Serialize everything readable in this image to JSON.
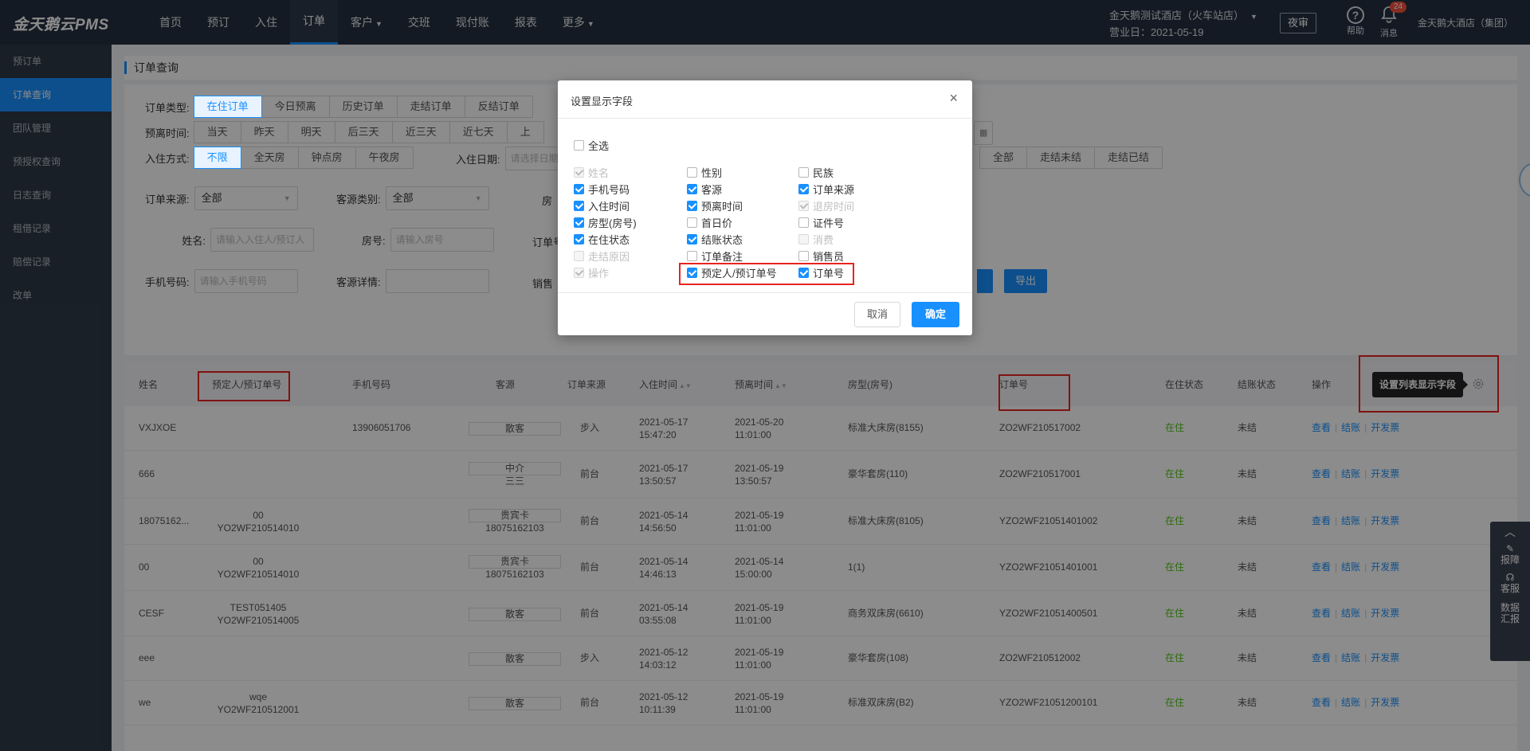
{
  "app": {
    "logo": "金天鹅云PMS"
  },
  "nav": {
    "items": [
      {
        "label": "首页"
      },
      {
        "label": "预订"
      },
      {
        "label": "入住"
      },
      {
        "label": "订单"
      },
      {
        "label": "客户"
      },
      {
        "label": "交班"
      },
      {
        "label": "现付账"
      },
      {
        "label": "报表"
      },
      {
        "label": "更多"
      }
    ]
  },
  "header": {
    "hotel_name": "金天鹅测试酒店（火车站店）",
    "business_date": "营业日：2021-05-19",
    "night_audit": "夜审",
    "help": "帮助",
    "messages": "消息",
    "message_count": "24",
    "group": "金天鹅大酒店（集团）"
  },
  "sidebar": {
    "items": [
      {
        "label": "预订单"
      },
      {
        "label": "订单查询"
      },
      {
        "label": "团队管理"
      },
      {
        "label": "预授权查询"
      },
      {
        "label": "日志查询"
      },
      {
        "label": "租借记录"
      },
      {
        "label": "赔偿记录"
      },
      {
        "label": "改单"
      }
    ]
  },
  "page": {
    "title": "订单查询"
  },
  "filters": {
    "order_type": {
      "label": "订单类型:",
      "options": [
        "在住订单",
        "今日预离",
        "历史订单",
        "走结订单",
        "反结订单"
      ]
    },
    "departure": {
      "label": "预离时间:",
      "options": [
        "当天",
        "昨天",
        "明天",
        "后三天",
        "近三天",
        "近七天",
        "上"
      ]
    },
    "checkin_mode": {
      "label": "入住方式:",
      "options": [
        "不限",
        "全天房",
        "钟点房",
        "午夜房"
      ]
    },
    "checkin_date": {
      "label": "入住日期:",
      "placeholder": "请选择日期"
    },
    "settle": {
      "options": [
        "全部",
        "走结未结",
        "走结已结"
      ]
    },
    "order_source": {
      "label": "订单来源:",
      "value": "全部"
    },
    "guest_type": {
      "label": "客源类别:",
      "value": "全部"
    },
    "room_type_label": "房",
    "name": {
      "label": "姓名:",
      "placeholder": "请输入入住人/预订人"
    },
    "room_no": {
      "label": "房号:",
      "placeholder": "请输入房号"
    },
    "order_no_label": "订单号",
    "phone": {
      "label": "手机号码:",
      "placeholder": "请输入手机号码"
    },
    "guest_detail": {
      "label": "客源详情:"
    },
    "seller_label": "销售",
    "export": "导出"
  },
  "table": {
    "headers": [
      "姓名",
      "预定人/预订单号",
      "手机号码",
      "客源",
      "订单来源",
      "入住时间",
      "预离时间",
      "房型(房号)",
      "订单号",
      "在住状态",
      "结账状态",
      "操作"
    ],
    "tooltip": "设置列表显示字段",
    "actions": {
      "view": "查看",
      "settle": "结账",
      "invoice": "开发票"
    },
    "rows": [
      {
        "name": "VXJXOE",
        "booker": "",
        "booker_no": "",
        "phone": "13906051706",
        "source1": "散客",
        "source2": "",
        "channel": "步入",
        "in_date": "2021-05-17",
        "in_time": "15:47:20",
        "out_date": "2021-05-20",
        "out_time": "11:01:00",
        "room": "标准大床房(8155)",
        "order_no": "ZO2WF210517002",
        "status": "在住",
        "settle": "未结"
      },
      {
        "name": "666",
        "booker": "",
        "booker_no": "",
        "phone": "",
        "source1": "中介",
        "source2": "三三",
        "channel": "前台",
        "in_date": "2021-05-17",
        "in_time": "13:50:57",
        "out_date": "2021-05-19",
        "out_time": "13:50:57",
        "room": "豪华套房(110)",
        "order_no": "ZO2WF210517001",
        "status": "在住",
        "settle": "未结"
      },
      {
        "name": "18075162...",
        "booker": "00",
        "booker_no": "YO2WF210514010",
        "phone": "",
        "source1": "贵宾卡",
        "source2": "18075162103",
        "channel": "前台",
        "in_date": "2021-05-14",
        "in_time": "14:56:50",
        "out_date": "2021-05-19",
        "out_time": "11:01:00",
        "room": "标准大床房(8105)",
        "order_no": "YZO2WF21051401002",
        "status": "在住",
        "settle": "未结"
      },
      {
        "name": "00",
        "booker": "00",
        "booker_no": "YO2WF210514010",
        "phone": "",
        "source1": "贵宾卡",
        "source2": "18075162103",
        "channel": "前台",
        "in_date": "2021-05-14",
        "in_time": "14:46:13",
        "out_date": "2021-05-14",
        "out_time": "15:00:00",
        "room": "1(1)",
        "order_no": "YZO2WF21051401001",
        "status": "在住",
        "settle": "未结"
      },
      {
        "name": "CESF",
        "booker": "TEST051405",
        "booker_no": "YO2WF210514005",
        "phone": "",
        "source1": "散客",
        "source2": "",
        "channel": "前台",
        "in_date": "2021-05-14",
        "in_time": "03:55:08",
        "out_date": "2021-05-19",
        "out_time": "11:01:00",
        "room": "商务双床房(6610)",
        "order_no": "YZO2WF21051400501",
        "status": "在住",
        "settle": "未结"
      },
      {
        "name": "eee",
        "booker": "",
        "booker_no": "",
        "phone": "",
        "source1": "散客",
        "source2": "",
        "channel": "步入",
        "in_date": "2021-05-12",
        "in_time": "14:03:12",
        "out_date": "2021-05-19",
        "out_time": "11:01:00",
        "room": "豪华套房(108)",
        "order_no": "ZO2WF210512002",
        "status": "在住",
        "settle": "未结"
      },
      {
        "name": "we",
        "booker": "wqe",
        "booker_no": "YO2WF210512001",
        "phone": "",
        "source1": "散客",
        "source2": "",
        "channel": "前台",
        "in_date": "2021-05-12",
        "in_time": "10:11:39",
        "out_date": "2021-05-19",
        "out_time": "11:01:00",
        "room": "标准双床房(B2)",
        "order_no": "YZO2WF21051200101",
        "status": "在住",
        "settle": "未结"
      }
    ]
  },
  "float_bar": {
    "report": "报障",
    "service": "客服",
    "data1": "数据",
    "data2": "汇报"
  },
  "modal": {
    "title": "设置显示字段",
    "select_all": "全选",
    "fields": [
      {
        "label": "姓名",
        "checked": true,
        "disabled": true
      },
      {
        "label": "性别",
        "checked": false,
        "disabled": false
      },
      {
        "label": "民族",
        "checked": false,
        "disabled": false
      },
      {
        "label": "手机号码",
        "checked": true,
        "disabled": false
      },
      {
        "label": "客源",
        "checked": true,
        "disabled": false
      },
      {
        "label": "订单来源",
        "checked": true,
        "disabled": false
      },
      {
        "label": "入住时间",
        "checked": true,
        "disabled": false
      },
      {
        "label": "预离时间",
        "checked": true,
        "disabled": false
      },
      {
        "label": "退房时间",
        "checked": true,
        "disabled": true
      },
      {
        "label": "房型(房号)",
        "checked": true,
        "disabled": false
      },
      {
        "label": "首日价",
        "checked": false,
        "disabled": false
      },
      {
        "label": "证件号",
        "checked": false,
        "disabled": false
      },
      {
        "label": "在住状态",
        "checked": true,
        "disabled": false
      },
      {
        "label": "结账状态",
        "checked": true,
        "disabled": false
      },
      {
        "label": "消费",
        "checked": false,
        "disabled": true
      },
      {
        "label": "走结原因",
        "checked": false,
        "disabled": true
      },
      {
        "label": "订单备注",
        "checked": false,
        "disabled": false
      },
      {
        "label": "销售员",
        "checked": false,
        "disabled": false
      },
      {
        "label": "操作",
        "checked": true,
        "disabled": true
      },
      {
        "label": "预定人/预订单号",
        "checked": true,
        "disabled": false
      },
      {
        "label": "订单号",
        "checked": true,
        "disabled": false
      }
    ],
    "cancel": "取消",
    "confirm": "确定"
  }
}
